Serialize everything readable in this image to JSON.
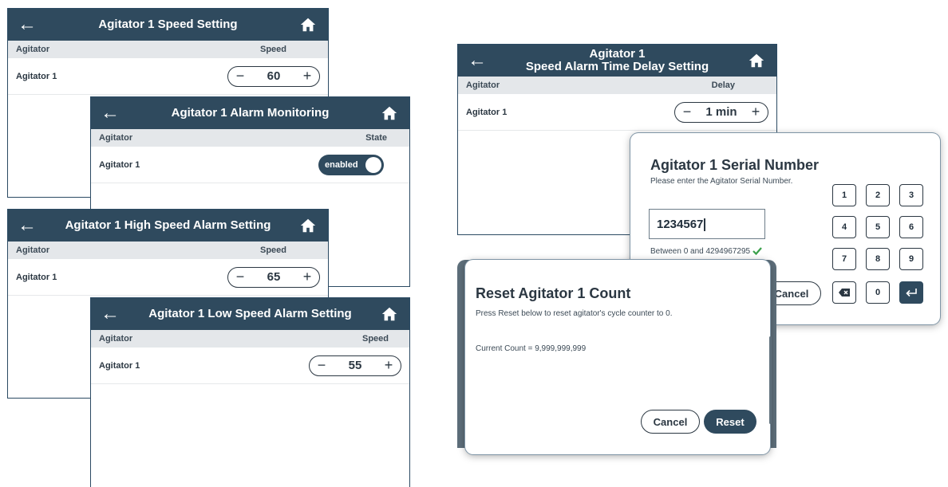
{
  "screens": {
    "speed": {
      "title": "Agitator 1 Speed Setting",
      "col_left": "Agitator",
      "col_right": "Speed",
      "row_label": "Agitator 1",
      "value": "60",
      "minus": "−",
      "plus": "+"
    },
    "alarm_monitoring": {
      "title": "Agitator 1 Alarm Monitoring",
      "col_left": "Agitator",
      "col_right": "State",
      "row_label": "Agitator 1",
      "toggle_label": "enabled"
    },
    "high_speed": {
      "title": "Agitator 1 High Speed Alarm Setting",
      "col_left": "Agitator",
      "col_right": "Speed",
      "row_label": "Agitator 1",
      "value": "65",
      "minus": "−",
      "plus": "+"
    },
    "low_speed": {
      "title": "Agitator 1 Low Speed Alarm Setting",
      "col_left": "Agitator",
      "col_right": "Speed",
      "row_label": "Agitator 1",
      "value": "55",
      "minus": "−",
      "plus": "+"
    },
    "time_delay": {
      "title_line1": "Agitator 1",
      "title_line2": "Speed Alarm Time Delay Setting",
      "col_left": "Agitator",
      "col_right": "Delay",
      "row_label": "Agitator 1",
      "value": "1 min",
      "minus": "−",
      "plus": "+"
    }
  },
  "serial_dialog": {
    "title": "Agitator 1 Serial Number",
    "subtitle": "Please enter the Agitator Serial Number.",
    "input_value": "1234567",
    "range_hint": "Between 0 and 4294967295",
    "cancel_label": "Cancel",
    "keys": [
      "1",
      "2",
      "3",
      "4",
      "5",
      "6",
      "7",
      "8",
      "9",
      "0"
    ]
  },
  "reset_dialog": {
    "title": "Reset Agitator 1 Count",
    "instructions": "Press Reset below to reset agitator's cycle counter to 0.",
    "current_count": "Current Count = 9,999,999,999",
    "cancel_label": "Cancel",
    "reset_label": "Reset"
  },
  "icons": {
    "back": "back-arrow-icon",
    "home": "home-icon",
    "backspace": "backspace-icon",
    "enter": "enter-icon",
    "check": "check-icon"
  },
  "colors": {
    "header": "#2f4a5e",
    "column_header": "#e4e7ea",
    "valid_check": "#3aa04a"
  }
}
